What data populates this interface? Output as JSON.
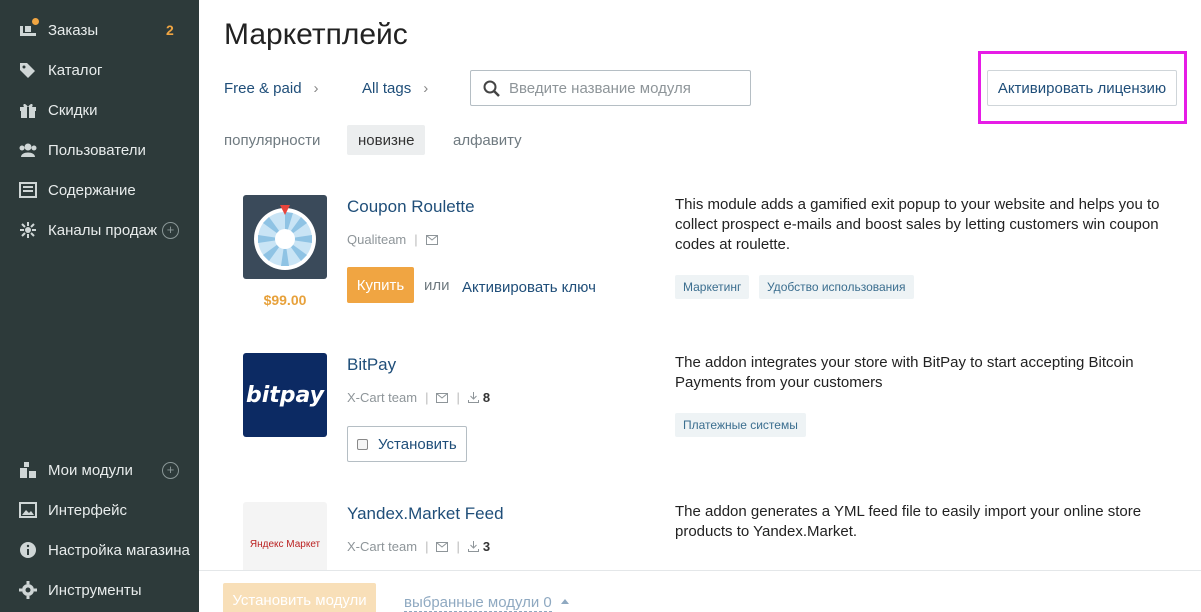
{
  "sidebar": {
    "items": [
      {
        "label": "Заказы",
        "icon": "orders-icon",
        "badge": "2"
      },
      {
        "label": "Каталог",
        "icon": "tag-icon"
      },
      {
        "label": "Скидки",
        "icon": "gift-icon"
      },
      {
        "label": "Пользователи",
        "icon": "users-icon"
      },
      {
        "label": "Содержание",
        "icon": "content-icon"
      },
      {
        "label": "Каналы продаж",
        "icon": "channels-icon"
      },
      {
        "label": "Мои модули",
        "icon": "modules-icon"
      },
      {
        "label": "Интерфейс",
        "icon": "image-icon"
      },
      {
        "label": "Настройка магазина",
        "icon": "info-icon"
      },
      {
        "label": "Инструменты",
        "icon": "gear-icon"
      }
    ]
  },
  "header": {
    "title": "Маркетплейс",
    "filter_price": "Free & paid",
    "filter_tags": "All tags",
    "search_placeholder": "Введите название модуля",
    "activate_license": "Активировать лицензию"
  },
  "sort": {
    "popularity": "популярности",
    "newest": "новизне",
    "alphabet": "алфавиту"
  },
  "modules": [
    {
      "title": "Coupon Roulette",
      "author": "Qualiteam",
      "description": "This module adds a gamified exit popup to your website and helps you to collect prospect e-mails and boost sales by letting customers win coupon codes at roulette.",
      "tags": [
        "Маркетинг",
        "Удобство использования"
      ],
      "price": "$99.00",
      "buy_label": "Купить",
      "or_label": "или",
      "activate_key_label": "Активировать ключ"
    },
    {
      "title": "BitPay",
      "author": "X-Cart team",
      "downloads": "8",
      "logo_text": "bitpay",
      "description": "The addon integrates your store with BitPay to start accepting Bitcoin Payments from your customers",
      "tags": [
        "Платежные системы"
      ],
      "install_label": "Установить"
    },
    {
      "title": "Yandex.Market Feed",
      "author": "X-Cart team",
      "downloads": "3",
      "logo_text": "Яндекс Маркет",
      "description": "The addon generates a YML feed file to easily import your online store products to Yandex.Market."
    }
  ],
  "bottom": {
    "install_modules": "Установить модули",
    "selected_modules": "выбранные модули 0"
  },
  "colors": {
    "sidebar_bg": "#2d3a3a",
    "accent": "#f0a542",
    "link": "#1f4e79",
    "highlight_box": "#e61ce6"
  }
}
